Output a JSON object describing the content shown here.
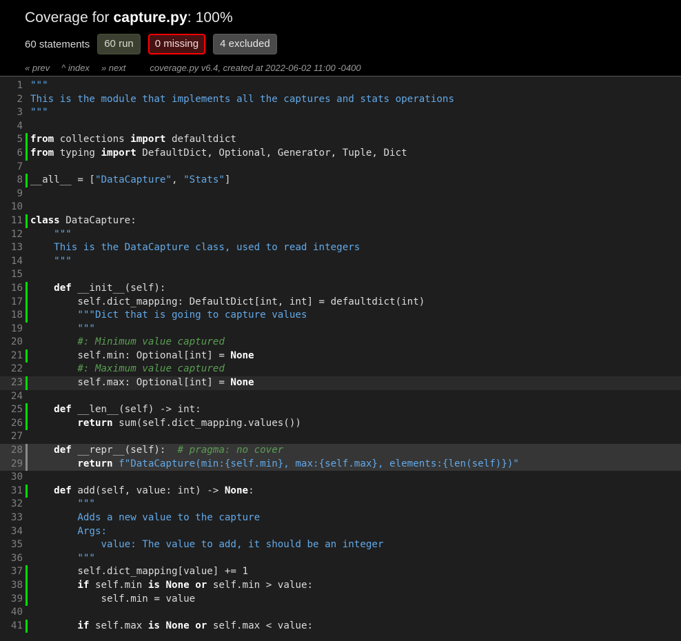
{
  "header": {
    "title_prefix": "Coverage for ",
    "title_file": "capture.py",
    "title_suffix": ": 100%",
    "stats": {
      "statements": "60 statements",
      "run": "60 run",
      "missing": "0 missing",
      "excluded": "4 excluded"
    },
    "nav": {
      "prev": "« prev",
      "index": "^ index",
      "next": "» next"
    },
    "meta": "coverage.py v6.4, created at 2022-06-02 11:00 -0400"
  },
  "colors": {
    "header_bg": "#000000",
    "body_bg": "#1e1e1e",
    "run_marker": "#00dd00",
    "excluded_marker": "#8a8a8a",
    "missing_border": "#ff0000",
    "run_pill_bg": "#3c4030",
    "missing_pill_bg": "#481212",
    "excluded_pill_bg": "#4a4a4a",
    "string": "#63a9e8",
    "comment": "#5a9e52",
    "keyword": "#ffffff",
    "text": "#dcdcdc",
    "lineno": "#808080"
  },
  "source_lines": [
    {
      "n": "1",
      "status": "",
      "tokens": [
        {
          "t": "\"\"\"",
          "c": "s"
        }
      ]
    },
    {
      "n": "2",
      "status": "",
      "tokens": [
        {
          "t": "This is the module that implements all the captures and stats operations",
          "c": "s"
        }
      ]
    },
    {
      "n": "3",
      "status": "",
      "tokens": [
        {
          "t": "\"\"\"",
          "c": "s"
        }
      ]
    },
    {
      "n": "4",
      "status": "",
      "tokens": []
    },
    {
      "n": "5",
      "status": "run",
      "tokens": [
        {
          "t": "from",
          "c": "k"
        },
        {
          "t": " collections ",
          "c": "nm"
        },
        {
          "t": "import",
          "c": "k"
        },
        {
          "t": " defaultdict",
          "c": "nm"
        }
      ]
    },
    {
      "n": "6",
      "status": "run",
      "tokens": [
        {
          "t": "from",
          "c": "k"
        },
        {
          "t": " typing ",
          "c": "nm"
        },
        {
          "t": "import",
          "c": "k"
        },
        {
          "t": " DefaultDict, Optional, Generator, Tuple, Dict",
          "c": "nm"
        }
      ]
    },
    {
      "n": "7",
      "status": "",
      "tokens": []
    },
    {
      "n": "8",
      "status": "run",
      "tokens": [
        {
          "t": "__all__ = [",
          "c": "nm"
        },
        {
          "t": "\"DataCapture\"",
          "c": "s"
        },
        {
          "t": ", ",
          "c": "nm"
        },
        {
          "t": "\"Stats\"",
          "c": "s"
        },
        {
          "t": "]",
          "c": "nm"
        }
      ]
    },
    {
      "n": "9",
      "status": "",
      "tokens": []
    },
    {
      "n": "10",
      "status": "",
      "tokens": []
    },
    {
      "n": "11",
      "status": "run",
      "tokens": [
        {
          "t": "class",
          "c": "k"
        },
        {
          "t": " DataCapture:",
          "c": "nm"
        }
      ]
    },
    {
      "n": "12",
      "status": "",
      "tokens": [
        {
          "t": "    ",
          "c": "nm"
        },
        {
          "t": "\"\"\"",
          "c": "s"
        }
      ]
    },
    {
      "n": "13",
      "status": "",
      "tokens": [
        {
          "t": "    ",
          "c": "nm"
        },
        {
          "t": "This is the DataCapture class, used to read integers",
          "c": "s"
        }
      ]
    },
    {
      "n": "14",
      "status": "",
      "tokens": [
        {
          "t": "    ",
          "c": "nm"
        },
        {
          "t": "\"\"\"",
          "c": "s"
        }
      ]
    },
    {
      "n": "15",
      "status": "",
      "tokens": []
    },
    {
      "n": "16",
      "status": "run",
      "tokens": [
        {
          "t": "    ",
          "c": "nm"
        },
        {
          "t": "def",
          "c": "k"
        },
        {
          "t": " __init__(self):",
          "c": "nm"
        }
      ]
    },
    {
      "n": "17",
      "status": "run",
      "tokens": [
        {
          "t": "        self.dict_mapping: DefaultDict[int, int] = defaultdict(int)",
          "c": "nm"
        }
      ]
    },
    {
      "n": "18",
      "status": "run",
      "tokens": [
        {
          "t": "        ",
          "c": "nm"
        },
        {
          "t": "\"\"\"Dict that is going to capture values",
          "c": "s"
        }
      ]
    },
    {
      "n": "19",
      "status": "",
      "tokens": [
        {
          "t": "        ",
          "c": "nm"
        },
        {
          "t": "\"\"\"",
          "c": "s"
        }
      ]
    },
    {
      "n": "20",
      "status": "",
      "tokens": [
        {
          "t": "        ",
          "c": "nm"
        },
        {
          "t": "#: Minimum value captured",
          "c": "c"
        }
      ]
    },
    {
      "n": "21",
      "status": "run",
      "tokens": [
        {
          "t": "        self.min: Optional[int] = ",
          "c": "nm"
        },
        {
          "t": "None",
          "c": "k"
        }
      ]
    },
    {
      "n": "22",
      "status": "",
      "tokens": [
        {
          "t": "        ",
          "c": "nm"
        },
        {
          "t": "#: Maximum value captured",
          "c": "c"
        }
      ]
    },
    {
      "n": "23",
      "status": "run hover",
      "tokens": [
        {
          "t": "        self.max: Optional[int] = ",
          "c": "nm"
        },
        {
          "t": "None",
          "c": "k"
        }
      ]
    },
    {
      "n": "24",
      "status": "",
      "tokens": []
    },
    {
      "n": "25",
      "status": "run",
      "tokens": [
        {
          "t": "    ",
          "c": "nm"
        },
        {
          "t": "def",
          "c": "k"
        },
        {
          "t": " __len__(self) -> int:",
          "c": "nm"
        }
      ]
    },
    {
      "n": "26",
      "status": "run",
      "tokens": [
        {
          "t": "        ",
          "c": "nm"
        },
        {
          "t": "return",
          "c": "k"
        },
        {
          "t": " sum(self.dict_mapping.values())",
          "c": "nm"
        }
      ]
    },
    {
      "n": "27",
      "status": "",
      "tokens": []
    },
    {
      "n": "28",
      "status": "exc",
      "tokens": [
        {
          "t": "    ",
          "c": "nm"
        },
        {
          "t": "def",
          "c": "k"
        },
        {
          "t": " __repr__(self):  ",
          "c": "nm"
        },
        {
          "t": "# pragma: no cover",
          "c": "c"
        }
      ]
    },
    {
      "n": "29",
      "status": "exc",
      "tokens": [
        {
          "t": "        ",
          "c": "nm"
        },
        {
          "t": "return",
          "c": "k"
        },
        {
          "t": " ",
          "c": "nm"
        },
        {
          "t": "f\"DataCapture(min:{self.min}, max:{self.max}, elements:{len(self)})\"",
          "c": "s"
        }
      ]
    },
    {
      "n": "30",
      "status": "",
      "tokens": []
    },
    {
      "n": "31",
      "status": "run",
      "tokens": [
        {
          "t": "    ",
          "c": "nm"
        },
        {
          "t": "def",
          "c": "k"
        },
        {
          "t": " add(self, value: int) -> ",
          "c": "nm"
        },
        {
          "t": "None",
          "c": "k"
        },
        {
          "t": ":",
          "c": "nm"
        }
      ]
    },
    {
      "n": "32",
      "status": "",
      "tokens": [
        {
          "t": "        ",
          "c": "nm"
        },
        {
          "t": "\"\"\"",
          "c": "s"
        }
      ]
    },
    {
      "n": "33",
      "status": "",
      "tokens": [
        {
          "t": "        ",
          "c": "nm"
        },
        {
          "t": "Adds a new value to the capture",
          "c": "s"
        }
      ]
    },
    {
      "n": "34",
      "status": "",
      "tokens": [
        {
          "t": "        ",
          "c": "nm"
        },
        {
          "t": "Args:",
          "c": "s"
        }
      ]
    },
    {
      "n": "35",
      "status": "",
      "tokens": [
        {
          "t": "            ",
          "c": "nm"
        },
        {
          "t": "value: The value to add, it should be an integer",
          "c": "s"
        }
      ]
    },
    {
      "n": "36",
      "status": "",
      "tokens": [
        {
          "t": "        ",
          "c": "nm"
        },
        {
          "t": "\"\"\"",
          "c": "s"
        }
      ]
    },
    {
      "n": "37",
      "status": "run",
      "tokens": [
        {
          "t": "        self.dict_mapping[value] += 1",
          "c": "nm"
        }
      ]
    },
    {
      "n": "38",
      "status": "run",
      "tokens": [
        {
          "t": "        ",
          "c": "nm"
        },
        {
          "t": "if",
          "c": "k"
        },
        {
          "t": " self.min ",
          "c": "nm"
        },
        {
          "t": "is",
          "c": "k"
        },
        {
          "t": " ",
          "c": "nm"
        },
        {
          "t": "None",
          "c": "k"
        },
        {
          "t": " ",
          "c": "nm"
        },
        {
          "t": "or",
          "c": "k"
        },
        {
          "t": " self.min > value:",
          "c": "nm"
        }
      ]
    },
    {
      "n": "39",
      "status": "run",
      "tokens": [
        {
          "t": "            self.min = value",
          "c": "nm"
        }
      ]
    },
    {
      "n": "40",
      "status": "",
      "tokens": []
    },
    {
      "n": "41",
      "status": "run",
      "tokens": [
        {
          "t": "        ",
          "c": "nm"
        },
        {
          "t": "if",
          "c": "k"
        },
        {
          "t": " self.max ",
          "c": "nm"
        },
        {
          "t": "is",
          "c": "k"
        },
        {
          "t": " ",
          "c": "nm"
        },
        {
          "t": "None",
          "c": "k"
        },
        {
          "t": " ",
          "c": "nm"
        },
        {
          "t": "or",
          "c": "k"
        },
        {
          "t": " self.max < value:",
          "c": "nm"
        }
      ]
    }
  ]
}
